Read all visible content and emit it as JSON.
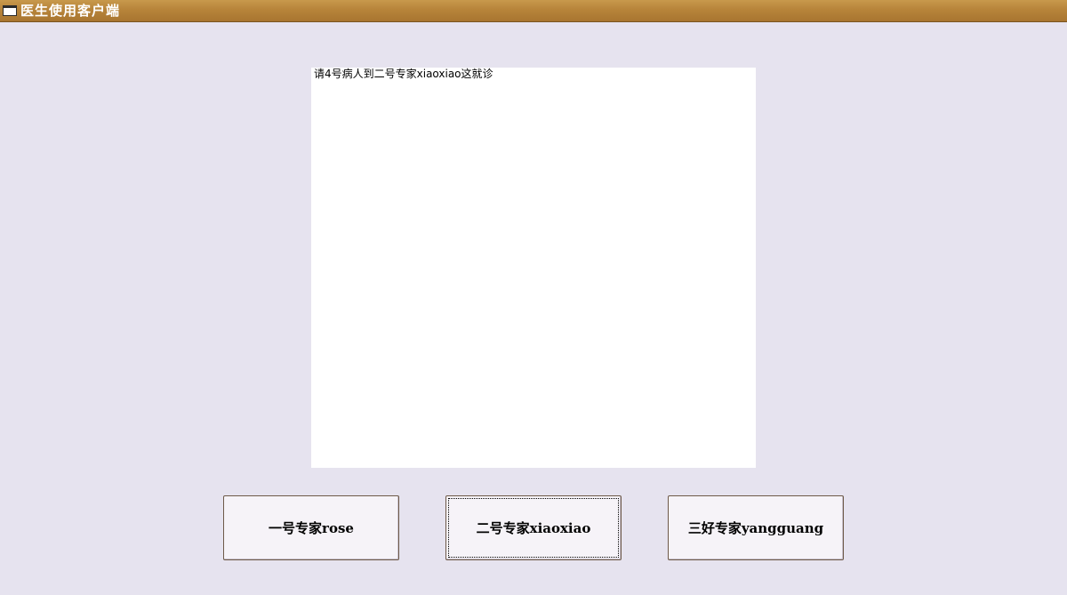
{
  "window": {
    "title": "医生使用客户端",
    "icon": "window-icon"
  },
  "message_area": {
    "text": "请4号病人到二号专家xiaoxiao这就诊"
  },
  "buttons": [
    {
      "label": "一号专家rose"
    },
    {
      "label": "二号专家xiaoxiao"
    },
    {
      "label": "三好专家yangguang"
    }
  ],
  "colors": {
    "titlebar": "#b7843a",
    "background": "#e6e3ef",
    "button_face": "#f6f3f8"
  }
}
